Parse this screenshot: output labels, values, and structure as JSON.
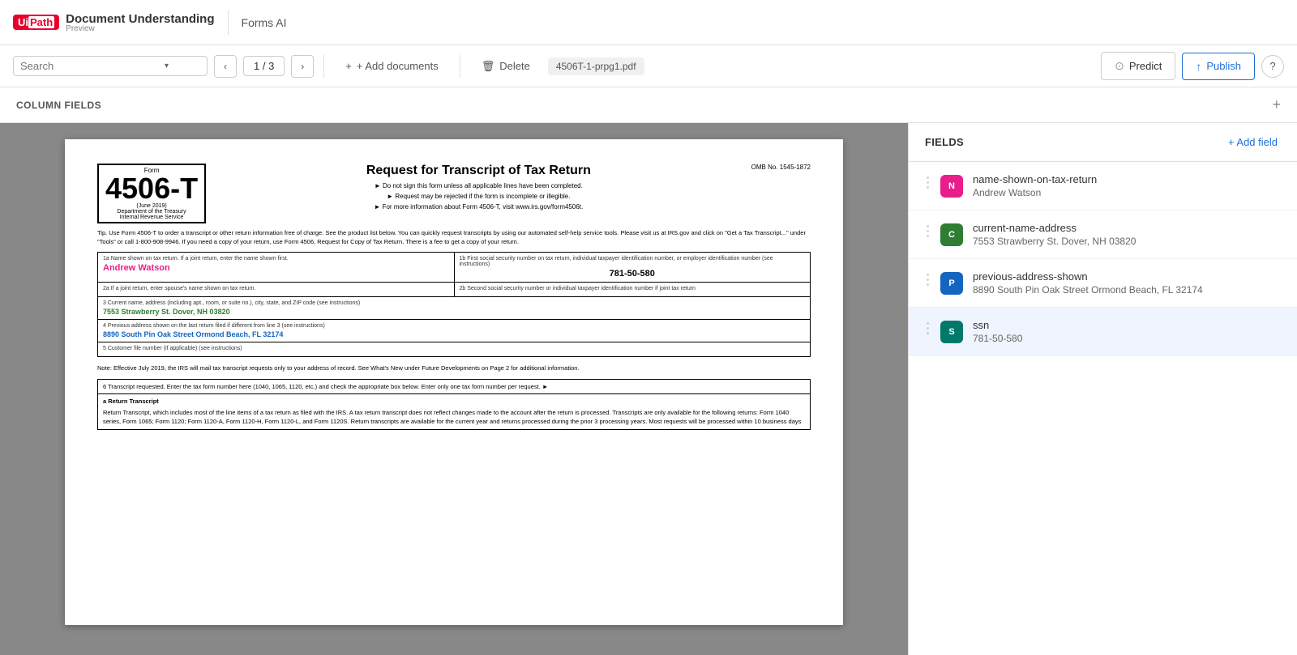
{
  "app": {
    "logo_ui": "Ui",
    "logo_path": "Path",
    "product_name": "Document Understanding",
    "product_sub": "Preview",
    "section": "Forms AI"
  },
  "toolbar": {
    "search_placeholder": "Search",
    "page_current": "1",
    "page_total": "3",
    "page_display": "1 / 3",
    "add_docs_label": "+ Add documents",
    "delete_label": "Delete",
    "filename": "4506T-1-prpg1.pdf",
    "predict_label": "Predict",
    "publish_label": "Publish",
    "help_label": "?"
  },
  "column_fields": {
    "label": "COLUMN FIELDS",
    "add_icon": "+"
  },
  "fields_panel": {
    "title": "FIELDS",
    "add_field_label": "+ Add field",
    "items": [
      {
        "id": "name-shown-on-tax-return",
        "badge_letter": "N",
        "badge_color": "pink",
        "name": "name-shown-on-tax-return",
        "value": "Andrew Watson"
      },
      {
        "id": "current-name-address",
        "badge_letter": "C",
        "badge_color": "green",
        "name": "current-name-address",
        "value": "7553 Strawberry St. Dover, NH 03820"
      },
      {
        "id": "previous-address-shown",
        "badge_letter": "P",
        "badge_color": "blue",
        "name": "previous-address-shown",
        "value": "8890 South Pin Oak Street Ormond Beach, FL 32174"
      },
      {
        "id": "ssn",
        "badge_letter": "S",
        "badge_color": "teal",
        "name": "ssn",
        "value": "781-50-580"
      }
    ]
  },
  "document": {
    "form_number": "4506-T",
    "form_label": "Form",
    "form_date": "(June 2019)",
    "form_agency1": "Department of the Treasury",
    "form_agency2": "Internal Revenue Service",
    "title": "Request for Transcript of Tax Return",
    "inst1": "► Do not sign this form unless all applicable lines have been completed.",
    "inst2": "► Request may be rejected if the form is incomplete or illegible.",
    "inst3": "► For more information about Form 4506-T, visit www.irs.gov/form4506t.",
    "omb": "OMB No. 1545-1872",
    "tip": "Tip. Use Form 4506-T to order a transcript or other return information free of charge. See the product list below. You can quickly request transcripts by using our automated self-help service tools. Please visit us at IRS.gov and click on \"Get a Tax Transcript...\" under \"Tools\" or call 1-800-908-9946. If you need a copy of your return, use Form 4506, Request for Copy of Tax Return. There is a fee to get a copy of your return.",
    "field_1a_label": "1a  Name shown on tax return. If a joint return, enter the name shown first.",
    "field_1a_value": "Andrew Watson",
    "field_1b_label": "1b  First social security number on tax return, individual taxpayer identification number, or employer identification number (see instructions)",
    "field_1b_value": "781-50-580",
    "field_2a_label": "2a  If a joint return, enter spouse's name shown on tax return.",
    "field_2b_label": "2b  Second social security number or individual taxpayer identification number if joint tax return",
    "field_3_label": "3   Current name, address (including apt., room, or suite no.), city, state, and ZIP code (see instructions)",
    "field_3_value": "7553 Strawberry St. Dover, NH 03820",
    "field_4_label": "4   Previous address shown on the last return filed if different from line 3 (see instructions)",
    "field_4_value": "8890 South Pin Oak Street Ormond Beach, FL 32174",
    "field_5_label": "5   Customer file number (if applicable) (see instructions)",
    "note": "Note: Effective July 2019, the IRS will mail tax transcript requests only to your address of record. See What's New under Future Developments on Page 2 for additional information.",
    "field_6_label": "6   Transcript requested. Enter the tax form number here (1040, 1065, 1120, etc.) and check the appropriate box below. Enter only one tax form number per request. ►",
    "field_6a_label": "a   Return Transcript",
    "field_6a_text": "Return Transcript, which includes most of the line items of a tax return as filed with the IRS. A tax return transcript does not reflect changes made to the account after the return is processed. Transcripts are only available for the following returns: Form 1040 series, Form 1065; Form 1120; Form 1120-A, Form 1120-H, Form 1120-L, and Form 1120S. Return transcripts are available for the current year and returns processed during the prior 3 processing years. Most requests will be processed within 10 business days"
  }
}
